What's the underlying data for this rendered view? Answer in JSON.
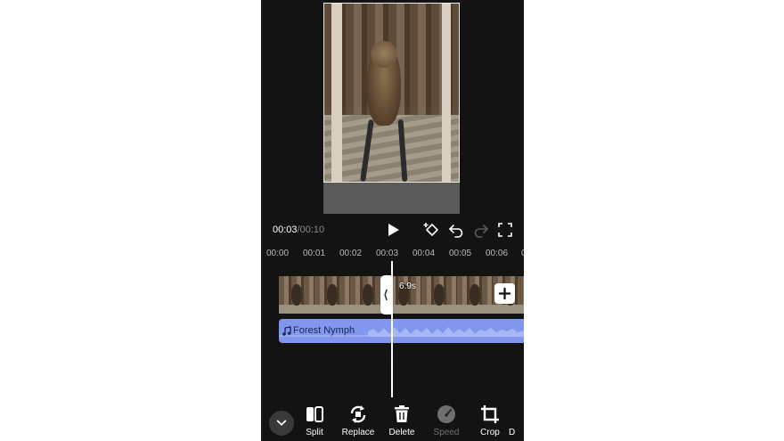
{
  "player": {
    "current_time": "00:03",
    "separator": "/",
    "total_time": "00:10"
  },
  "timeline": {
    "ruler": [
      "00:00",
      "00:01",
      "00:02",
      "00:03",
      "00:04",
      "00:05",
      "00:06",
      "00"
    ],
    "clip_duration": "6.9s"
  },
  "audio": {
    "track_name": "Forest Nymph"
  },
  "toolbar": {
    "tools": [
      {
        "label": "Split",
        "icon": "split-icon",
        "enabled": true
      },
      {
        "label": "Replace",
        "icon": "replace-icon",
        "enabled": true
      },
      {
        "label": "Delete",
        "icon": "trash-icon",
        "enabled": true
      },
      {
        "label": "Speed",
        "icon": "speedometer-icon",
        "enabled": false
      },
      {
        "label": "Crop",
        "icon": "crop-icon",
        "enabled": true
      },
      {
        "label": "D",
        "icon": "more-tool-icon",
        "enabled": true
      }
    ]
  },
  "colors": {
    "background": "#131313",
    "audio_track": "#8096ef",
    "audio_wave": "#aebcf5",
    "text_muted": "#8a8a8a"
  }
}
